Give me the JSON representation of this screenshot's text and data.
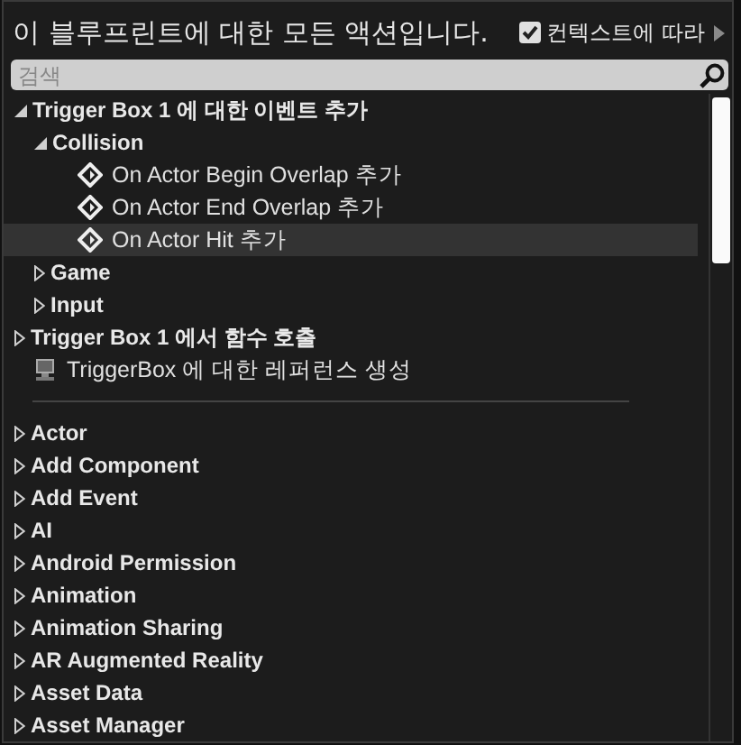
{
  "header": {
    "title": "이 블루프린트에 대한 모든 액션입니다.",
    "context_toggle": {
      "label": "컨텍스트에 따라",
      "checked": true
    }
  },
  "search": {
    "placeholder": "검색"
  },
  "tree": [
    {
      "kind": "category",
      "label": "Trigger Box 1 에 대한 이벤트 추가",
      "expanded": true,
      "selected": false,
      "children": [
        {
          "kind": "category",
          "label": "Collision",
          "expanded": true,
          "selected": false,
          "children": [
            {
              "kind": "event",
              "label": "On Actor Begin Overlap 추가",
              "selected": false
            },
            {
              "kind": "event",
              "label": "On Actor End Overlap 추가",
              "selected": false
            },
            {
              "kind": "event",
              "label": "On Actor Hit 추가",
              "selected": true
            }
          ]
        },
        {
          "kind": "category",
          "label": "Game",
          "expanded": false,
          "selected": false
        },
        {
          "kind": "category",
          "label": "Input",
          "expanded": false,
          "selected": false
        }
      ]
    },
    {
      "kind": "category",
      "label": "Trigger Box 1 에서 함수 호출",
      "expanded": false,
      "selected": false
    },
    {
      "kind": "reference",
      "label": "TriggerBox 에 대한 레퍼런스 생성",
      "selected": false
    },
    {
      "kind": "separator"
    },
    {
      "kind": "category",
      "label": "Actor",
      "expanded": false,
      "selected": false
    },
    {
      "kind": "category",
      "label": "Add Component",
      "expanded": false,
      "selected": false
    },
    {
      "kind": "category",
      "label": "Add Event",
      "expanded": false,
      "selected": false
    },
    {
      "kind": "category",
      "label": "AI",
      "expanded": false,
      "selected": false
    },
    {
      "kind": "category",
      "label": "Android Permission",
      "expanded": false,
      "selected": false
    },
    {
      "kind": "category",
      "label": "Animation",
      "expanded": false,
      "selected": false
    },
    {
      "kind": "category",
      "label": "Animation Sharing",
      "expanded": false,
      "selected": false
    },
    {
      "kind": "category",
      "label": "AR Augmented Reality",
      "expanded": false,
      "selected": false
    },
    {
      "kind": "category",
      "label": "Asset Data",
      "expanded": false,
      "selected": false
    },
    {
      "kind": "category",
      "label": "Asset Manager",
      "expanded": false,
      "selected": false
    }
  ]
}
